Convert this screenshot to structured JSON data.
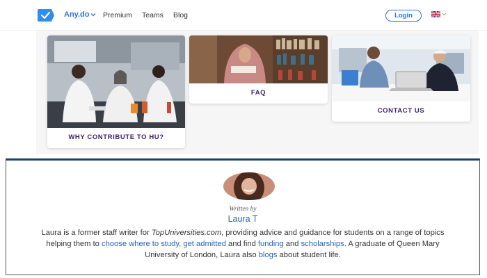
{
  "nav": {
    "logo_icon": "anydo-check-logo-icon",
    "brand": "Any.do",
    "links": [
      "Premium",
      "Teams",
      "Blog"
    ],
    "login": "Login",
    "language_icon": "uk-flag-icon",
    "accent": "#2f6fe0"
  },
  "cards": [
    {
      "label": "WHY CONTRIBUTE TO HU?",
      "image": "lab-students-photo"
    },
    {
      "label": "FAQ",
      "image": "library-student-photo"
    },
    {
      "label": "CONTACT US",
      "image": "students-laptop-photo"
    }
  ],
  "author": {
    "written_by": "Written by",
    "name": "Laura T",
    "bio": {
      "p1": "Laura is a former staff writer for ",
      "site": "TopUniversities.com",
      "p2": ", providing advice and guidance for students on a range of topics helping them to ",
      "link1": "choose where to study",
      "p3": ", ",
      "link2": "get admitted",
      "p4": " and find ",
      "link3": "funding",
      "p5": " and ",
      "link4": "scholarships",
      "p6": ". A graduate of Queen Mary University of London, Laura also ",
      "link5": "blogs",
      "p7": " about student life."
    },
    "link_color": "#2a5fb8"
  }
}
